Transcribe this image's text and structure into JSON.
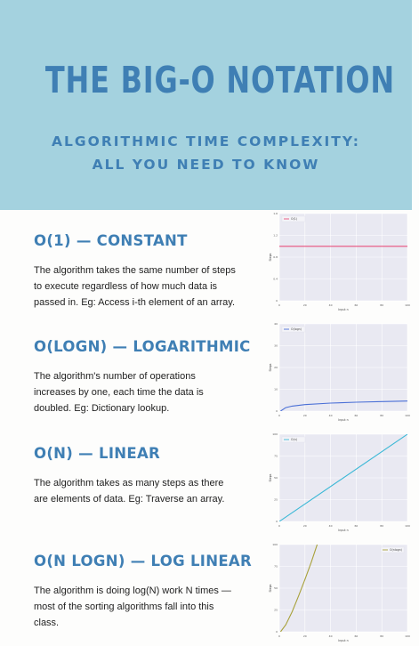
{
  "header": {
    "title": "THE BIG-O NOTATION",
    "subtitle_line1": "ALGORITHMIC TIME COMPLEXITY:",
    "subtitle_line2": "ALL YOU NEED TO KNOW"
  },
  "sections": [
    {
      "title": "O(1) — CONSTANT",
      "desc": [
        "The algorithm takes the same number of steps",
        "to execute regardless of how much data is",
        "passed in. Eg: Access i-th element of an array."
      ]
    },
    {
      "title": "O(LOGN) — LOGARITHMIC",
      "desc": [
        "The algorithm's number of operations",
        "increases by one, each time the data is",
        "doubled. Eg: Dictionary lookup."
      ]
    },
    {
      "title": "O(N) — LINEAR",
      "desc": [
        "The algorithm takes as many steps as there",
        "are elements of data. Eg: Traverse an array."
      ]
    },
    {
      "title": "O(N LOGN) — LOG LINEAR",
      "desc": [
        "The algorithm is doing log(N) work N times —",
        "most of the sorting algorithms fall into this",
        "class."
      ]
    }
  ],
  "colors": {
    "header_bg": "#a4d2df",
    "accent": "#3f7fb4",
    "plot_bg": "#e9e9f2",
    "constant": "#e8507d",
    "logarithmic": "#4a6fd6",
    "linear": "#3cb8d6",
    "loglinear": "#a8a13a"
  },
  "chart_data": [
    {
      "type": "line",
      "series": [
        {
          "name": "O(1)",
          "x": [
            0,
            100
          ],
          "values": [
            1,
            1
          ]
        }
      ],
      "xlim": [
        0,
        100
      ],
      "ylim": [
        0,
        1.6
      ],
      "xticks": [
        "0",
        "20",
        "40",
        "60",
        "80",
        "100"
      ],
      "xlabel": "Input n",
      "ylabel": "Steps",
      "legend": "top-left",
      "color": "#e8507d"
    },
    {
      "type": "line",
      "series": [
        {
          "name": "O(logn)",
          "x": [
            1,
            5,
            10,
            20,
            40,
            60,
            80,
            100
          ],
          "values": [
            0,
            1.61,
            2.3,
            3.0,
            3.69,
            4.09,
            4.38,
            4.61
          ]
        }
      ],
      "xlim": [
        0,
        100
      ],
      "ylim": [
        0,
        40
      ],
      "xticks": [
        "0",
        "20",
        "40",
        "60",
        "80",
        "100"
      ],
      "xlabel": "Input n",
      "ylabel": "Steps",
      "legend": "top-left",
      "color": "#4a6fd6"
    },
    {
      "type": "line",
      "series": [
        {
          "name": "O(n)",
          "x": [
            0,
            100
          ],
          "values": [
            0,
            100
          ]
        }
      ],
      "xlim": [
        0,
        100
      ],
      "ylim": [
        0,
        100
      ],
      "xticks": [
        "0",
        "20",
        "40",
        "60",
        "80",
        "100"
      ],
      "xlabel": "Input n",
      "ylabel": "Steps",
      "legend": "top-left",
      "color": "#3cb8d6"
    },
    {
      "type": "line",
      "series": [
        {
          "name": "O(nlogn)",
          "x": [
            1,
            5,
            10,
            15,
            20,
            25,
            30,
            35,
            40,
            45
          ],
          "values": [
            0,
            8,
            23,
            41,
            60,
            80,
            102,
            124,
            148,
            171
          ]
        }
      ],
      "xlim": [
        0,
        100
      ],
      "ylim": [
        0,
        100
      ],
      "xticks": [
        "0",
        "20",
        "40",
        "60",
        "80",
        "100"
      ],
      "xlabel": "Input n",
      "ylabel": "Steps",
      "legend": "top-right",
      "color": "#a8a13a"
    }
  ]
}
